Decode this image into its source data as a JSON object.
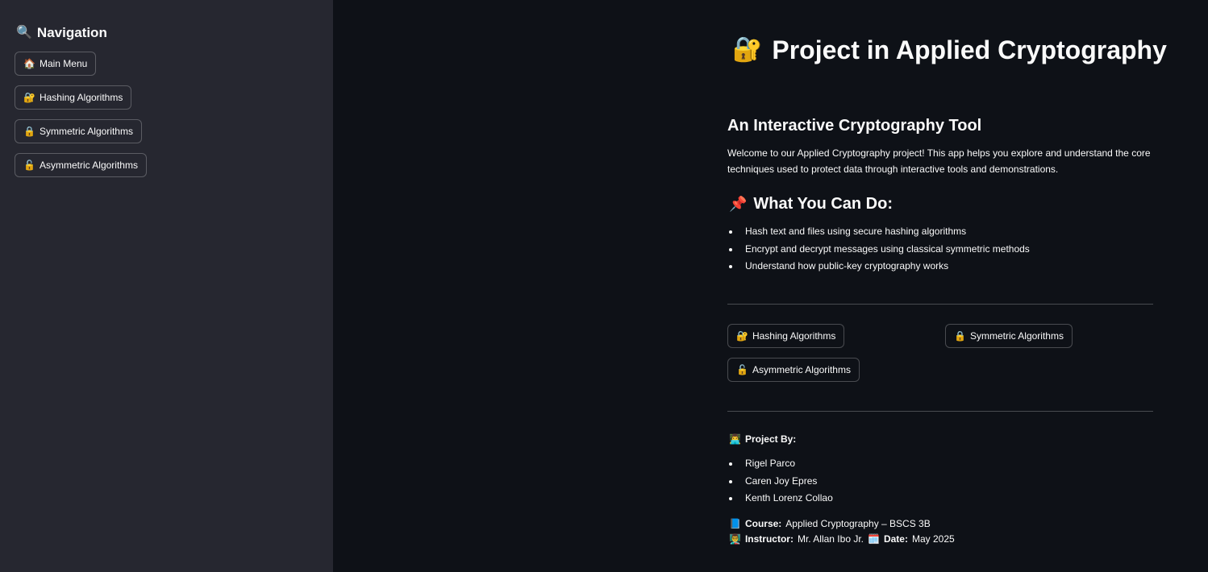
{
  "sidebar": {
    "title": "Navigation",
    "title_icon": "🔍",
    "buttons": [
      {
        "icon": "🏠",
        "label": "Main Menu"
      },
      {
        "icon": "🔐",
        "label": "Hashing Algorithms"
      },
      {
        "icon": "🔒",
        "label": "Symmetric Algorithms"
      },
      {
        "icon": "🔓",
        "label": "Asymmetric Algorithms"
      }
    ]
  },
  "main": {
    "title_icon": "🔐",
    "title": "Project in Applied Cryptography",
    "subtitle": "An Interactive Cryptography Tool",
    "intro_line1": "Welcome to our Applied Cryptography project! This app helps you explore and understand the core",
    "intro_line2": "techniques used to protect data through interactive tools and demonstrations.",
    "features_icon": "📌",
    "features_heading": "What You Can Do:",
    "features": [
      "Hash text and files using secure hashing algorithms",
      "Encrypt and decrypt messages using classical symmetric methods",
      "Understand how public-key cryptography works"
    ],
    "buttons": [
      {
        "icon": "🔐",
        "label": "Hashing Algorithms"
      },
      {
        "icon": "🔒",
        "label": "Symmetric Algorithms"
      },
      {
        "icon": "🔓",
        "label": "Asymmetric Algorithms"
      }
    ],
    "project_by_icon": "👨‍💻",
    "project_by_label": "Project By:",
    "members": [
      "Rigel Parco",
      "Caren Joy Epres",
      "Kenth Lorenz Collao"
    ],
    "course_icon": "📘",
    "course_label": "Course:",
    "course_value": "Applied Cryptography – BSCS 3B",
    "instructor_icon": "👨‍🏫",
    "instructor_label": "Instructor:",
    "instructor_value": "Mr. Allan Ibo Jr.",
    "date_icon": "🗓️",
    "date_label": "Date:",
    "date_value": "May 2025"
  }
}
